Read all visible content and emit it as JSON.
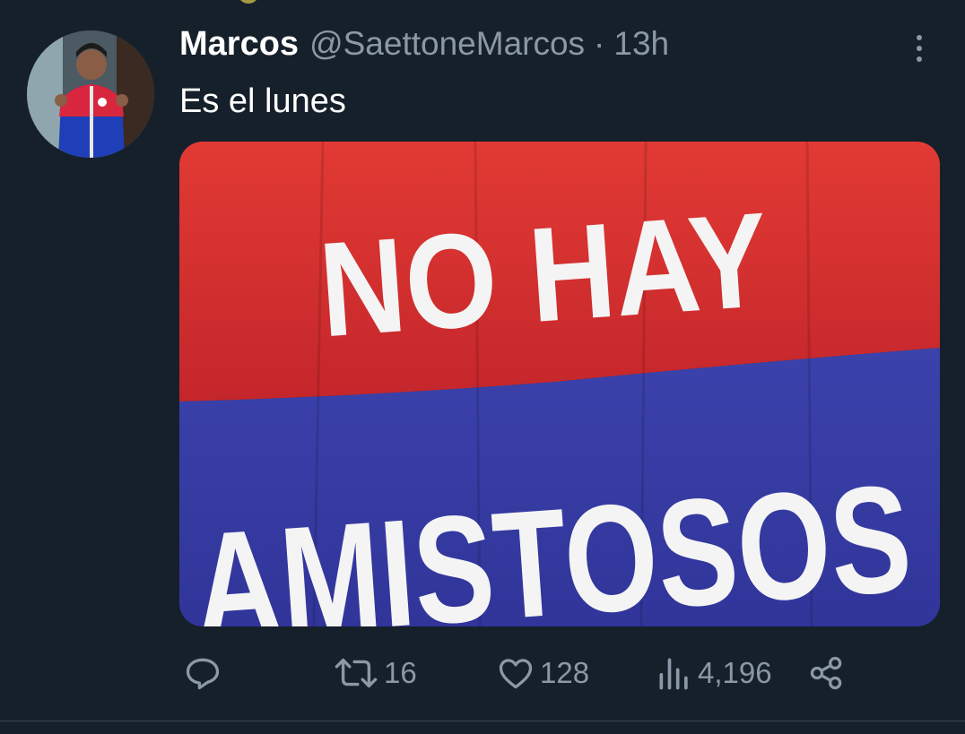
{
  "tweet": {
    "author_name": "Marcos",
    "author_handle": "@SaettoneMarcos",
    "separator": "·",
    "time": "13h",
    "text": "Es el lunes",
    "media": {
      "banner_line1": "NO HAY",
      "banner_line2": "AMISTOSOS",
      "top_color": "#d52b2f",
      "bottom_color": "#3a3fa6"
    },
    "actions": {
      "reply_icon": "reply-icon",
      "retweet_icon": "retweet-icon",
      "retweet_count": "16",
      "like_icon": "heart-icon",
      "like_count": "128",
      "views_icon": "views-icon",
      "view_count": "4,196",
      "share_icon": "share-icon"
    }
  },
  "colors": {
    "background": "#15202b",
    "secondary_text": "#8b98a5",
    "divider": "#38444d"
  }
}
